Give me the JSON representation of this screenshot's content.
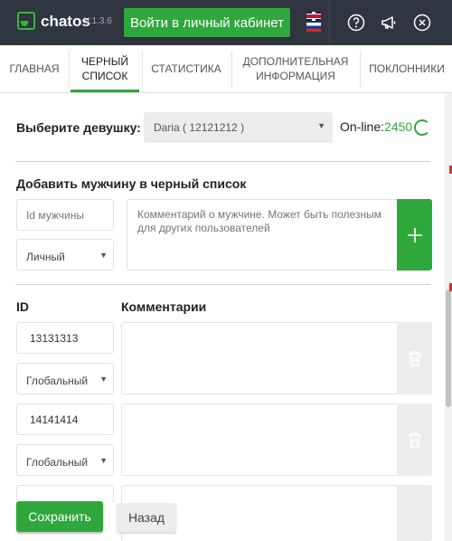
{
  "header": {
    "logo_text": "chatos",
    "version": "V.1.3.6",
    "login_button": "Войти в личный кабинет",
    "bg_color": "#2f3640",
    "accent_color": "#2fa83b"
  },
  "tabs": [
    {
      "label": "ГЛАВНАЯ",
      "active": false
    },
    {
      "label": "ЧЕРНЫЙ СПИСОК",
      "active": true
    },
    {
      "label": "СТАТИСТИКА",
      "active": false
    },
    {
      "label": "ДОПОЛНИТЕЛЬНАЯ ИНФОРМАЦИЯ",
      "active": false
    },
    {
      "label": "ПОКЛОННИКИ",
      "active": false
    }
  ],
  "girl_select": {
    "label": "Выберите девушку:",
    "value": "Daria ( 12121212 )",
    "online_label": "On-line:",
    "online_count": "2450"
  },
  "add_section": {
    "title": "Добавить мужчину в черный список",
    "id_placeholder": "Id мужчины",
    "type_value": "Личный",
    "comment_placeholder": "Комментарий о мужчине. Может быть полезным для других пользователей"
  },
  "list": {
    "col_id": "ID",
    "col_comments": "Комментарии",
    "rows": [
      {
        "id": "13131313",
        "scope": "Глобальный"
      },
      {
        "id": "14141414",
        "scope": "Глобальный"
      }
    ]
  },
  "footer": {
    "save": "Сохранить",
    "back": "Назад"
  }
}
